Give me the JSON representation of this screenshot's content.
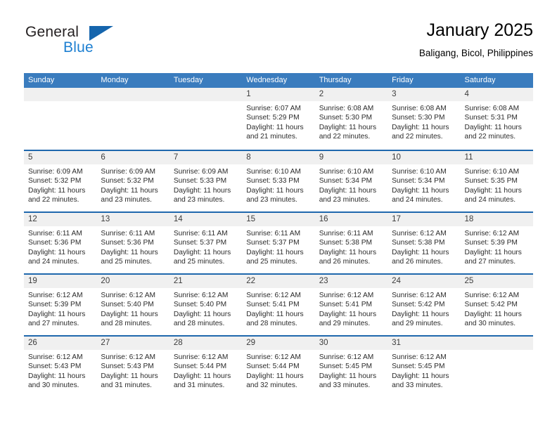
{
  "brand": {
    "name_top": "General",
    "name_bottom": "Blue",
    "triangle_icon": "triangle-icon",
    "accent_color": "#1d7fd1",
    "header_color": "#3a7cbe",
    "row_rule_color": "#1f68ad"
  },
  "header": {
    "title": "January 2025",
    "subtitle": "Baligang, Bicol, Philippines"
  },
  "weekdays": [
    "Sunday",
    "Monday",
    "Tuesday",
    "Wednesday",
    "Thursday",
    "Friday",
    "Saturday"
  ],
  "weeks": [
    [
      {
        "day": "",
        "sunrise": "",
        "sunset": "",
        "daylight1": "",
        "daylight2": ""
      },
      {
        "day": "",
        "sunrise": "",
        "sunset": "",
        "daylight1": "",
        "daylight2": ""
      },
      {
        "day": "",
        "sunrise": "",
        "sunset": "",
        "daylight1": "",
        "daylight2": ""
      },
      {
        "day": "1",
        "sunrise": "Sunrise: 6:07 AM",
        "sunset": "Sunset: 5:29 PM",
        "daylight1": "Daylight: 11 hours",
        "daylight2": "and 21 minutes."
      },
      {
        "day": "2",
        "sunrise": "Sunrise: 6:08 AM",
        "sunset": "Sunset: 5:30 PM",
        "daylight1": "Daylight: 11 hours",
        "daylight2": "and 22 minutes."
      },
      {
        "day": "3",
        "sunrise": "Sunrise: 6:08 AM",
        "sunset": "Sunset: 5:30 PM",
        "daylight1": "Daylight: 11 hours",
        "daylight2": "and 22 minutes."
      },
      {
        "day": "4",
        "sunrise": "Sunrise: 6:08 AM",
        "sunset": "Sunset: 5:31 PM",
        "daylight1": "Daylight: 11 hours",
        "daylight2": "and 22 minutes."
      }
    ],
    [
      {
        "day": "5",
        "sunrise": "Sunrise: 6:09 AM",
        "sunset": "Sunset: 5:32 PM",
        "daylight1": "Daylight: 11 hours",
        "daylight2": "and 22 minutes."
      },
      {
        "day": "6",
        "sunrise": "Sunrise: 6:09 AM",
        "sunset": "Sunset: 5:32 PM",
        "daylight1": "Daylight: 11 hours",
        "daylight2": "and 23 minutes."
      },
      {
        "day": "7",
        "sunrise": "Sunrise: 6:09 AM",
        "sunset": "Sunset: 5:33 PM",
        "daylight1": "Daylight: 11 hours",
        "daylight2": "and 23 minutes."
      },
      {
        "day": "8",
        "sunrise": "Sunrise: 6:10 AM",
        "sunset": "Sunset: 5:33 PM",
        "daylight1": "Daylight: 11 hours",
        "daylight2": "and 23 minutes."
      },
      {
        "day": "9",
        "sunrise": "Sunrise: 6:10 AM",
        "sunset": "Sunset: 5:34 PM",
        "daylight1": "Daylight: 11 hours",
        "daylight2": "and 23 minutes."
      },
      {
        "day": "10",
        "sunrise": "Sunrise: 6:10 AM",
        "sunset": "Sunset: 5:34 PM",
        "daylight1": "Daylight: 11 hours",
        "daylight2": "and 24 minutes."
      },
      {
        "day": "11",
        "sunrise": "Sunrise: 6:10 AM",
        "sunset": "Sunset: 5:35 PM",
        "daylight1": "Daylight: 11 hours",
        "daylight2": "and 24 minutes."
      }
    ],
    [
      {
        "day": "12",
        "sunrise": "Sunrise: 6:11 AM",
        "sunset": "Sunset: 5:36 PM",
        "daylight1": "Daylight: 11 hours",
        "daylight2": "and 24 minutes."
      },
      {
        "day": "13",
        "sunrise": "Sunrise: 6:11 AM",
        "sunset": "Sunset: 5:36 PM",
        "daylight1": "Daylight: 11 hours",
        "daylight2": "and 25 minutes."
      },
      {
        "day": "14",
        "sunrise": "Sunrise: 6:11 AM",
        "sunset": "Sunset: 5:37 PM",
        "daylight1": "Daylight: 11 hours",
        "daylight2": "and 25 minutes."
      },
      {
        "day": "15",
        "sunrise": "Sunrise: 6:11 AM",
        "sunset": "Sunset: 5:37 PM",
        "daylight1": "Daylight: 11 hours",
        "daylight2": "and 25 minutes."
      },
      {
        "day": "16",
        "sunrise": "Sunrise: 6:11 AM",
        "sunset": "Sunset: 5:38 PM",
        "daylight1": "Daylight: 11 hours",
        "daylight2": "and 26 minutes."
      },
      {
        "day": "17",
        "sunrise": "Sunrise: 6:12 AM",
        "sunset": "Sunset: 5:38 PM",
        "daylight1": "Daylight: 11 hours",
        "daylight2": "and 26 minutes."
      },
      {
        "day": "18",
        "sunrise": "Sunrise: 6:12 AM",
        "sunset": "Sunset: 5:39 PM",
        "daylight1": "Daylight: 11 hours",
        "daylight2": "and 27 minutes."
      }
    ],
    [
      {
        "day": "19",
        "sunrise": "Sunrise: 6:12 AM",
        "sunset": "Sunset: 5:39 PM",
        "daylight1": "Daylight: 11 hours",
        "daylight2": "and 27 minutes."
      },
      {
        "day": "20",
        "sunrise": "Sunrise: 6:12 AM",
        "sunset": "Sunset: 5:40 PM",
        "daylight1": "Daylight: 11 hours",
        "daylight2": "and 28 minutes."
      },
      {
        "day": "21",
        "sunrise": "Sunrise: 6:12 AM",
        "sunset": "Sunset: 5:40 PM",
        "daylight1": "Daylight: 11 hours",
        "daylight2": "and 28 minutes."
      },
      {
        "day": "22",
        "sunrise": "Sunrise: 6:12 AM",
        "sunset": "Sunset: 5:41 PM",
        "daylight1": "Daylight: 11 hours",
        "daylight2": "and 28 minutes."
      },
      {
        "day": "23",
        "sunrise": "Sunrise: 6:12 AM",
        "sunset": "Sunset: 5:41 PM",
        "daylight1": "Daylight: 11 hours",
        "daylight2": "and 29 minutes."
      },
      {
        "day": "24",
        "sunrise": "Sunrise: 6:12 AM",
        "sunset": "Sunset: 5:42 PM",
        "daylight1": "Daylight: 11 hours",
        "daylight2": "and 29 minutes."
      },
      {
        "day": "25",
        "sunrise": "Sunrise: 6:12 AM",
        "sunset": "Sunset: 5:42 PM",
        "daylight1": "Daylight: 11 hours",
        "daylight2": "and 30 minutes."
      }
    ],
    [
      {
        "day": "26",
        "sunrise": "Sunrise: 6:12 AM",
        "sunset": "Sunset: 5:43 PM",
        "daylight1": "Daylight: 11 hours",
        "daylight2": "and 30 minutes."
      },
      {
        "day": "27",
        "sunrise": "Sunrise: 6:12 AM",
        "sunset": "Sunset: 5:43 PM",
        "daylight1": "Daylight: 11 hours",
        "daylight2": "and 31 minutes."
      },
      {
        "day": "28",
        "sunrise": "Sunrise: 6:12 AM",
        "sunset": "Sunset: 5:44 PM",
        "daylight1": "Daylight: 11 hours",
        "daylight2": "and 31 minutes."
      },
      {
        "day": "29",
        "sunrise": "Sunrise: 6:12 AM",
        "sunset": "Sunset: 5:44 PM",
        "daylight1": "Daylight: 11 hours",
        "daylight2": "and 32 minutes."
      },
      {
        "day": "30",
        "sunrise": "Sunrise: 6:12 AM",
        "sunset": "Sunset: 5:45 PM",
        "daylight1": "Daylight: 11 hours",
        "daylight2": "and 33 minutes."
      },
      {
        "day": "31",
        "sunrise": "Sunrise: 6:12 AM",
        "sunset": "Sunset: 5:45 PM",
        "daylight1": "Daylight: 11 hours",
        "daylight2": "and 33 minutes."
      },
      {
        "day": "",
        "sunrise": "",
        "sunset": "",
        "daylight1": "",
        "daylight2": ""
      }
    ]
  ]
}
